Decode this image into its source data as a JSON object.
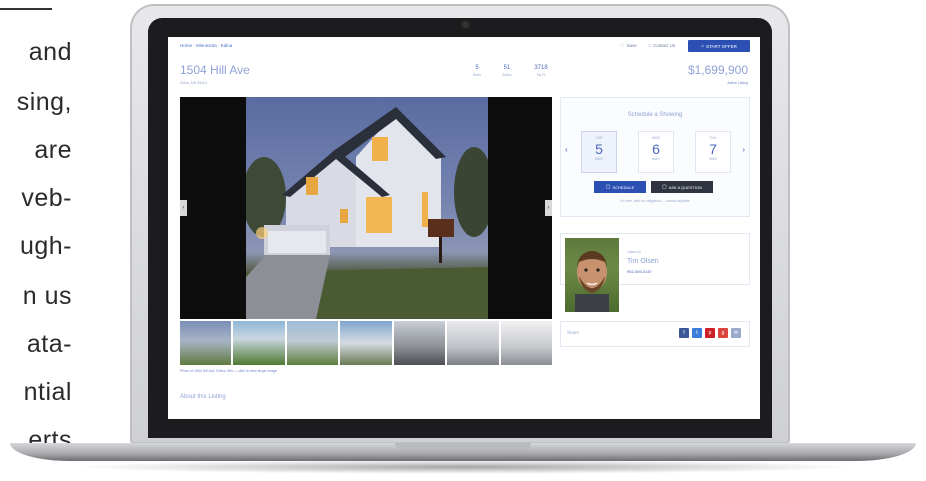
{
  "side_text": {
    "lines": [
      "and",
      "sing,",
      "are",
      "veb-",
      "ugh-",
      "n us",
      "ata-",
      "ntial",
      "erts"
    ]
  },
  "header": {
    "breadcrumb": "Home · Minnesota · Edina",
    "nav": {
      "save_label": "Save",
      "contact_label": "Contact Us",
      "start_label": "START OFFER"
    }
  },
  "listing": {
    "address": "1504 Hill Ave",
    "address_sub": "Edina, MN 55424",
    "stats": [
      {
        "value": "5",
        "label": "Beds"
      },
      {
        "value": "51",
        "label": "Baths"
      },
      {
        "value": "3718",
        "label": "Sq Ft"
      }
    ],
    "price": "$1,699,900",
    "price_sub": "Active Listing"
  },
  "gallery": {
    "caption": "Photo of 1504 Hill Ave, Edina, MN — click to view larger image",
    "thumb_count": 7
  },
  "description": {
    "heading": "About this Listing"
  },
  "schedule": {
    "title": "Schedule a Showing",
    "dates": [
      {
        "dow": "TUE",
        "day": "5",
        "month": "MAR"
      },
      {
        "dow": "WED",
        "day": "6",
        "month": "MAR"
      },
      {
        "dow": "THU",
        "day": "7",
        "month": "MAR"
      }
    ],
    "selected_index": 0,
    "schedule_label": "SCHEDULE",
    "ask_label": "ASK A QUESTION",
    "note": "It's free, with no obligation — cancel anytime"
  },
  "agent": {
    "role": "Listed by",
    "name": "Tim Olsen",
    "phone": "952-555-0187"
  },
  "share": {
    "label": "Share",
    "buttons": [
      {
        "name": "facebook-icon",
        "glyph": "f",
        "color": "#3b5998"
      },
      {
        "name": "twitter-icon",
        "glyph": "t",
        "color": "#3b7dd8"
      },
      {
        "name": "pinterest-icon",
        "glyph": "p",
        "color": "#cb2027"
      },
      {
        "name": "google-plus-icon",
        "glyph": "g",
        "color": "#d9453d"
      },
      {
        "name": "email-icon",
        "glyph": "✉",
        "color": "#9aa8cc"
      }
    ]
  }
}
